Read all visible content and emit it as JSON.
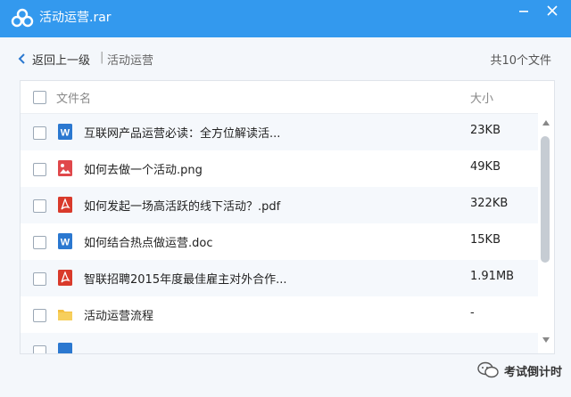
{
  "window": {
    "title": "活动运营.rar"
  },
  "nav": {
    "back_label": "返回上一级",
    "separator": "|",
    "current_folder": "活动运营",
    "count_label": "共10个文件"
  },
  "columns": {
    "name": "文件名",
    "size": "大小"
  },
  "files": [
    {
      "name": "互联网产品运营必读：全方位解读活...",
      "size": "23KB",
      "icon": "word-doc-icon"
    },
    {
      "name": "如何去做一个活动.png",
      "size": "49KB",
      "icon": "image-file-icon"
    },
    {
      "name": "如何发起一场高活跃的线下活动？.pdf",
      "size": "322KB",
      "icon": "pdf-file-icon"
    },
    {
      "name": "如何结合热点做运营.doc",
      "size": "15KB",
      "icon": "word-doc-icon"
    },
    {
      "name": "智联招聘2015年度最佳雇主对外合作...",
      "size": "1.91MB",
      "icon": "pdf-file-icon"
    },
    {
      "name": "活动运营流程",
      "size": "-",
      "icon": "folder-icon"
    }
  ],
  "watermark": {
    "text": "考试倒计时"
  },
  "colors": {
    "titlebar": "#3399ee",
    "word": "#2b78d0",
    "pdf": "#d93a2b",
    "image": "#e0484b",
    "folder": "#f4c042"
  }
}
